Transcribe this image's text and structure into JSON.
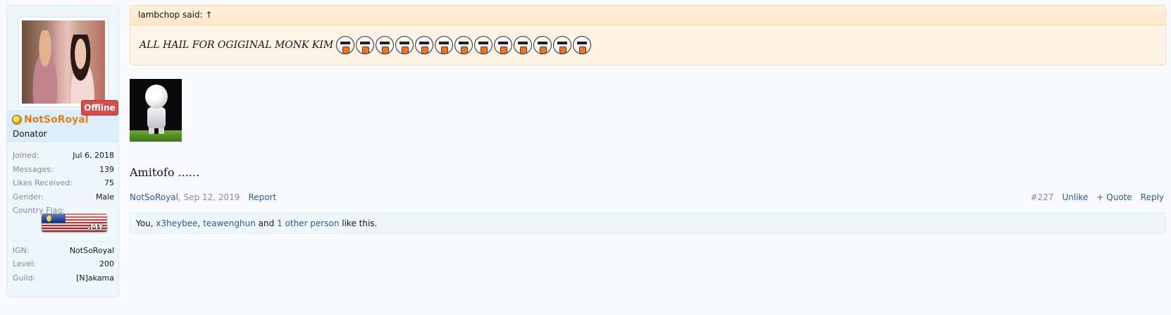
{
  "user": {
    "name": "NotSoRoyal",
    "title": "Donator",
    "status": "Offline",
    "stats": [
      {
        "label": "Joined:",
        "value": "Jul 6, 2018"
      },
      {
        "label": "Messages:",
        "value": "139"
      },
      {
        "label": "Likes Received:",
        "value": "75"
      },
      {
        "label": "Gender:",
        "value": "Male"
      },
      {
        "label": "Country Flag:",
        "value": ""
      }
    ],
    "flag_code": ".MY",
    "game": [
      {
        "label": "IGN:",
        "value": "NotSoRoyal"
      },
      {
        "label": "Level:",
        "value": "200"
      },
      {
        "label": "Guild:",
        "value": "[N]akama"
      }
    ]
  },
  "quote": {
    "author_line": "lambchop said: ↑",
    "text": "ALL HAIL FOR OGIGINAL MONK KIM",
    "emoji_count": 13
  },
  "post": {
    "message": "Amitofo ......",
    "author": "NotSoRoyal",
    "date": "Sep 12, 2019",
    "report_label": "Report",
    "number": "#227",
    "unlike_label": "Unlike",
    "quote_label": "+ Quote",
    "reply_label": "Reply"
  },
  "likes": {
    "prefix": "You, ",
    "user1": "x3heybee",
    "sep": ", ",
    "user2": "teawenghun",
    "mid": " and ",
    "others": "1 other person",
    "suffix": " like this."
  },
  "colors": {
    "username": "#e37d1b",
    "link": "#2d5b8d",
    "offline_badge": "#d44d4d",
    "quote_bg": "#fff4e5"
  }
}
